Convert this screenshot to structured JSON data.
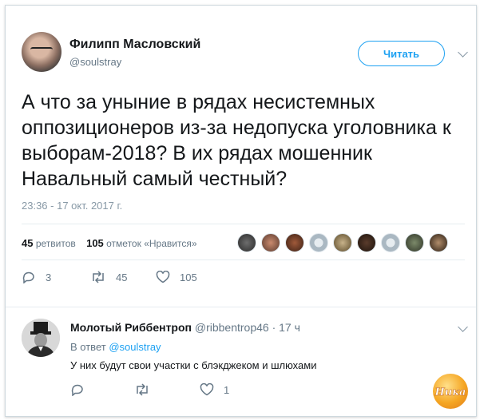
{
  "tweet": {
    "author_name": "Филипп Масловский",
    "author_handle": "@soulstray",
    "follow_label": "Читать",
    "text": "А что за уныние в рядах несистемных оппозиционеров из-за недопуска уголовника к выборам-2018? В их рядах мошенник Навальный самый честный?",
    "timestamp": "23:36 - 17 окт. 2017 г.",
    "retweets_count": "45",
    "retweets_label": "ретвитов",
    "likes_count": "105",
    "likes_label": "отметок «Нравится»",
    "actions": {
      "reply_count": "3",
      "retweet_count": "45",
      "like_count": "105"
    }
  },
  "reply": {
    "author_name": "Молотый Риббентроп",
    "author_handle": "@ribbentrop46",
    "time": "· 17 ч",
    "reply_prefix": "В ответ",
    "reply_to_handle": "@soulstray",
    "text": "У них будут свои участки с блэкджеком и шлюхами",
    "actions": {
      "like_count": "1"
    }
  },
  "watermark": {
    "text": "Ника"
  },
  "colors": {
    "accent": "#1da1f2",
    "secondary_text": "#657786",
    "primary_text": "#14171a"
  },
  "icons": {
    "reply": "reply-icon",
    "retweet": "retweet-icon",
    "like": "heart-icon",
    "menu": "chevron-down-icon"
  }
}
